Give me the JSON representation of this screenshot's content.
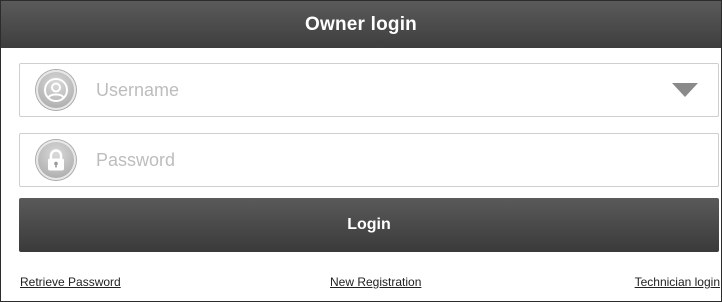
{
  "header": {
    "title": "Owner login"
  },
  "form": {
    "username_placeholder": "Username",
    "username_value": "",
    "password_placeholder": "Password",
    "password_value": "",
    "login_label": "Login"
  },
  "links": {
    "retrieve_password": "Retrieve Password",
    "new_registration": "New Registration",
    "technician_login": "Technician login"
  },
  "icons": {
    "username": "user-icon",
    "password": "lock-icon",
    "dropdown": "chevron-down-icon"
  },
  "colors": {
    "header_bg": "#4a4a4a",
    "button_bg": "#4a4a4a",
    "placeholder": "#bdbdbd"
  }
}
